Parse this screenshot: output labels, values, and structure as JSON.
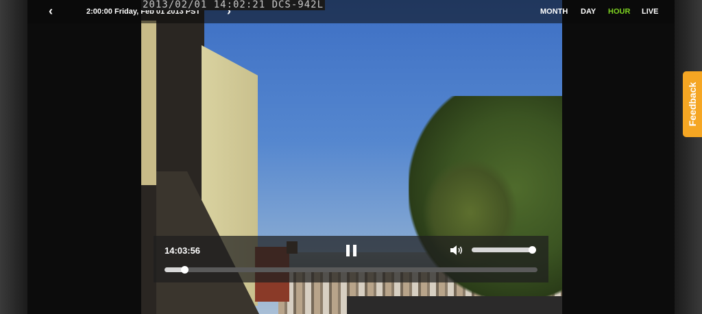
{
  "header": {
    "prev_label": "‹",
    "date_label": "2:00:00 Friday, Feb 01 2013 PST",
    "next_label": "›",
    "range_tabs": [
      {
        "label": "MONTH",
        "active": false
      },
      {
        "label": "DAY",
        "active": false
      },
      {
        "label": "HOUR",
        "active": true
      },
      {
        "label": "LIVE",
        "active": false
      }
    ],
    "active_color": "#7ed321"
  },
  "camera": {
    "overlay_text": "2013/02/01 14:02:21 DCS-942L"
  },
  "player": {
    "timecode": "14:03:56",
    "pause_icon": "pause-icon",
    "volume_icon": "volume-icon",
    "volume_level": 1.0,
    "progress_fraction": 0.045
  },
  "feedback": {
    "label": "Feedback",
    "color": "#f5a623"
  }
}
